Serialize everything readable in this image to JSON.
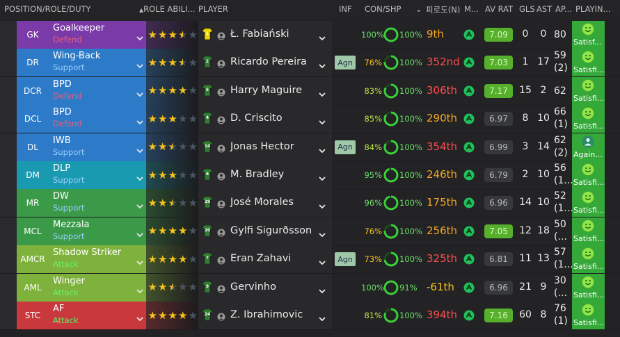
{
  "columns": {
    "position": "POSITION/ROLE/DUTY",
    "role_ability": "ROLE ABILI...",
    "player": "PLAYER",
    "inf": "INF",
    "con_shp": "CON/SHP",
    "korean": "피로도(N)",
    "m": "M...",
    "av_rat": "AV RAT",
    "gls": "GLS",
    "ast": "AST",
    "apps": "AP...",
    "playing": "PLAYIN..."
  },
  "rows": [
    {
      "pos": "GK",
      "role": "Goalkeeper",
      "duty": "Defend",
      "dutyType": "defend",
      "color": "#7a3aa8",
      "stars": [
        1,
        1,
        1,
        0.5,
        0
      ],
      "shirt": "#f2d400",
      "num": "1",
      "name": "Ł. Fabiański",
      "inf": "",
      "cond": "100%",
      "condColor": "#6ae06a",
      "condPct": 1.0,
      "shp": "100%",
      "rank": "9th",
      "rankColor": "#f5a623",
      "rat": "7.09",
      "ratType": "green",
      "gls": "0",
      "ast": "0",
      "apps1": "80",
      "apps2": "",
      "playTxt": "Satisf...",
      "face": "smile"
    },
    {
      "pos": "DR",
      "role": "Wing-Back",
      "duty": "Support",
      "dutyType": "support",
      "color": "#2d7bc8",
      "stars": [
        1,
        1,
        1,
        0.5,
        0
      ],
      "shirt": "#2e7d32",
      "num": "2",
      "name": "Ricardo Pereira",
      "inf": "Agn",
      "cond": "76%",
      "condColor": "#f5c31c",
      "condPct": 0.76,
      "shp": "100%",
      "rank": "352nd",
      "rankColor": "#ff4d4d",
      "rat": "7.03",
      "ratType": "green",
      "gls": "1",
      "ast": "17",
      "apps1": "59",
      "apps2": "(2)",
      "playTxt": "Satisfi...",
      "face": "smile"
    },
    {
      "pos": "DCR",
      "role": "BPD",
      "duty": "Defend",
      "dutyType": "defend",
      "color": "#2d7bc8",
      "stars": [
        1,
        1,
        1,
        1,
        0
      ],
      "shirt": "#2e7d32",
      "num": "5",
      "name": "Harry Maguire",
      "inf": "",
      "cond": "83%",
      "condColor": "#b8e04a",
      "condPct": 0.83,
      "shp": "100%",
      "rank": "306th",
      "rankColor": "#ff4d4d",
      "rat": "7.17",
      "ratType": "green",
      "gls": "15",
      "ast": "2",
      "apps1": "62",
      "apps2": "",
      "playTxt": "Satisfi...",
      "face": "smile"
    },
    {
      "pos": "DCL",
      "role": "BPD",
      "duty": "Defend",
      "dutyType": "defend",
      "color": "#2d7bc8",
      "stars": [
        1,
        1,
        1,
        0,
        0
      ],
      "shirt": "#2e7d32",
      "num": "4",
      "name": "D. Criscito",
      "inf": "",
      "cond": "85%",
      "condColor": "#b8e04a",
      "condPct": 0.85,
      "shp": "100%",
      "rank": "290th",
      "rankColor": "#f5a623",
      "rat": "6.97",
      "ratType": "grey",
      "gls": "8",
      "ast": "10",
      "apps1": "66",
      "apps2": "(1)",
      "playTxt": "Satisfi...",
      "face": "smile"
    },
    {
      "pos": "DL",
      "role": "IWB",
      "duty": "Support",
      "dutyType": "support",
      "color": "#2d7bc8",
      "stars": [
        1,
        1,
        0.5,
        0,
        0
      ],
      "shirt": "#2e7d32",
      "num": "14",
      "name": "Jonas Hector",
      "inf": "Agn",
      "cond": "84%",
      "condColor": "#b8e04a",
      "condPct": 0.84,
      "shp": "100%",
      "rank": "354th",
      "rankColor": "#ff4d4d",
      "rat": "6.99",
      "ratType": "grey",
      "gls": "3",
      "ast": "14",
      "apps1": "62",
      "apps2": "(2)",
      "playTxt": "Again...",
      "face": "person"
    },
    {
      "pos": "DM",
      "role": "DLP",
      "duty": "Support",
      "dutyType": "support",
      "color": "#1a9ab0",
      "stars": [
        1,
        1,
        1,
        0,
        0
      ],
      "shirt": "#2e7d32",
      "num": "6",
      "name": "M. Bradley",
      "inf": "",
      "cond": "95%",
      "condColor": "#6ae06a",
      "condPct": 0.95,
      "shp": "100%",
      "rank": "246th",
      "rankColor": "#f5a623",
      "rat": "6.79",
      "ratType": "grey",
      "gls": "2",
      "ast": "10",
      "apps1": "56",
      "apps2": "(1...",
      "playTxt": "Satisfi...",
      "face": "smile"
    },
    {
      "pos": "MR",
      "role": "DW",
      "duty": "Support",
      "dutyType": "support",
      "color": "#3a9a48",
      "stars": [
        1,
        1,
        0.5,
        0,
        0
      ],
      "shirt": "#2e7d32",
      "num": "29",
      "name": "José Morales",
      "inf": "",
      "cond": "96%",
      "condColor": "#6ae06a",
      "condPct": 0.96,
      "shp": "100%",
      "rank": "175th",
      "rankColor": "#f5a623",
      "rat": "6.96",
      "ratType": "grey",
      "gls": "14",
      "ast": "10",
      "apps1": "52",
      "apps2": "(1...",
      "playTxt": "Satisfi...",
      "face": "smile"
    },
    {
      "pos": "MCL",
      "role": "Mezzala",
      "duty": "Support",
      "dutyType": "support",
      "color": "#3a9a48",
      "stars": [
        1,
        1,
        1,
        1,
        0
      ],
      "shirt": "#2e7d32",
      "num": "20",
      "name": "Gylfi Sigurðsson",
      "inf": "",
      "cond": "76%",
      "condColor": "#f5c31c",
      "condPct": 0.76,
      "shp": "100%",
      "rank": "256th",
      "rankColor": "#f5a623",
      "rat": "7.05",
      "ratType": "green",
      "gls": "12",
      "ast": "18",
      "apps1": "50",
      "apps2": "(...",
      "playTxt": "Satisfi...",
      "face": "smile"
    },
    {
      "pos": "AMCR",
      "role": "Shadow Striker",
      "duty": "Attack",
      "dutyType": "attack",
      "color": "#7fb23c",
      "stars": [
        1,
        1,
        1,
        1,
        0
      ],
      "shirt": "#2e7d32",
      "num": "7",
      "name": "Eran Zahavi",
      "inf": "Agn",
      "cond": "73%",
      "condColor": "#f5c31c",
      "condPct": 0.73,
      "shp": "100%",
      "rank": "325th",
      "rankColor": "#ff4d4d",
      "rat": "6.81",
      "ratType": "grey",
      "gls": "11",
      "ast": "13",
      "apps1": "57",
      "apps2": "(1...",
      "playTxt": "Satisfi...",
      "face": "smile"
    },
    {
      "pos": "AML",
      "role": "Winger",
      "duty": "Attack",
      "dutyType": "attack",
      "color": "#7fb23c",
      "stars": [
        1,
        1,
        0.5,
        0,
        0
      ],
      "shirt": "#2e7d32",
      "num": "9",
      "name": "Gervinho",
      "inf": "",
      "cond": "100%",
      "condColor": "#6ae06a",
      "condPct": 1.0,
      "shp": "91%",
      "rank": "-61th",
      "rankColor": "#f5c31c",
      "rat": "6.96",
      "ratType": "grey",
      "gls": "21",
      "ast": "9",
      "apps1": "30",
      "apps2": "(...",
      "playTxt": "Satisfi...",
      "face": "smile"
    },
    {
      "pos": "STC",
      "role": "AF",
      "duty": "Attack",
      "dutyType": "attack",
      "color": "#c8383c",
      "stars": [
        1,
        1,
        1,
        1,
        0
      ],
      "shirt": "#2e7d32",
      "num": "24",
      "name": "Z. Ibrahimovic",
      "inf": "",
      "cond": "81%",
      "condColor": "#b8e04a",
      "condPct": 0.81,
      "shp": "100%",
      "rank": "394th",
      "rankColor": "#ff4d4d",
      "rat": "7.16",
      "ratType": "green",
      "gls": "60",
      "ast": "8",
      "apps1": "76",
      "apps2": "(1)",
      "playTxt": "Satisfi...",
      "face": "smile"
    }
  ]
}
